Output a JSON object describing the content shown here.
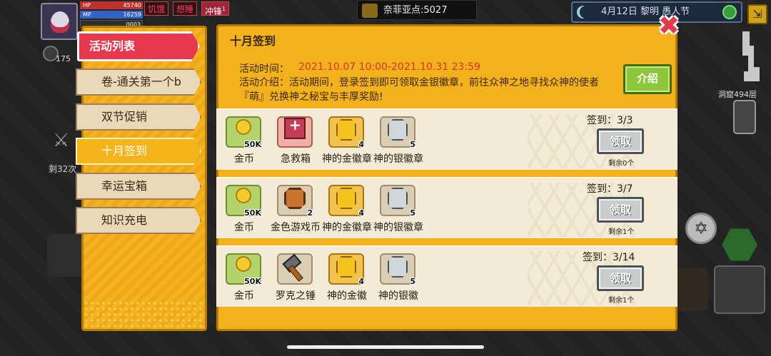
{
  "hud": {
    "hp_label": "HP",
    "hp_value": "45740",
    "mp_label": "MP",
    "mp_value": "16259",
    "xp_value": "0003",
    "status_hungry": "饥饿",
    "status_sleepy": "想睡",
    "status_charge": "冲锋",
    "status_charge_level": "1",
    "shield_count": "175",
    "nafilia_points": "奈菲亚点:5027",
    "date_weather": "4月12日  黎明  愚人节",
    "cave_floor": "洞窟494层",
    "left_count": "剩32次"
  },
  "tabs": {
    "header": "活动列表",
    "items": [
      {
        "label": "卷-通关第一个b",
        "active": false
      },
      {
        "label": "双节促销",
        "active": false
      },
      {
        "label": "十月签到",
        "active": true
      },
      {
        "label": "幸运宝箱",
        "active": false
      },
      {
        "label": "知识充电",
        "active": false
      }
    ]
  },
  "panel": {
    "title": "十月签到",
    "close_symbol": "✖",
    "time_label": "活动时间：",
    "time_value": "2021.10.07 10:00-2021.10.31 23:59",
    "desc": "活动介绍：活动期间，登录签到即可领取金银徽章，前往众神之地寻找众神的使者『萌』兑换神之秘宝与丰厚奖励!",
    "intro_button": "介绍"
  },
  "rows": [
    {
      "signin": "签到：3/3",
      "claim": "领取",
      "remain": "剩余0个",
      "items": [
        {
          "icon": "gold-coin-icon",
          "qty": "50K",
          "name": "金币"
        },
        {
          "icon": "first-aid-kit-icon",
          "qty": "",
          "name": "急救箱"
        },
        {
          "icon": "gold-badge-icon",
          "qty": "4",
          "name": "神的金徽章"
        },
        {
          "icon": "silver-badge-icon",
          "qty": "5",
          "name": "神的银徽章"
        }
      ]
    },
    {
      "signin": "签到：3/7",
      "claim": "领取",
      "remain": "剩余1个",
      "items": [
        {
          "icon": "gold-coin-icon",
          "qty": "50K",
          "name": "金币"
        },
        {
          "icon": "game-coin-icon",
          "qty": "2",
          "name": "金色游戏币"
        },
        {
          "icon": "gold-badge-icon",
          "qty": "4",
          "name": "神的金徽章"
        },
        {
          "icon": "silver-badge-icon",
          "qty": "5",
          "name": "神的银徽章"
        }
      ]
    },
    {
      "signin": "签到：3/14",
      "claim": "领取",
      "remain": "剩余1个",
      "items": [
        {
          "icon": "gold-coin-icon",
          "qty": "50K",
          "name": "金币"
        },
        {
          "icon": "hammer-icon",
          "qty": "",
          "name": "罗克之锤"
        },
        {
          "icon": "gold-badge-icon",
          "qty": "4",
          "name": "神的金徽"
        },
        {
          "icon": "silver-badge-icon",
          "qty": "5",
          "name": "神的银徽"
        }
      ]
    }
  ],
  "colors": {
    "panel_gold": "#f3b11b",
    "header_red": "#e8384f",
    "time_red": "#d63428",
    "intro_green": "#8cc63a"
  }
}
